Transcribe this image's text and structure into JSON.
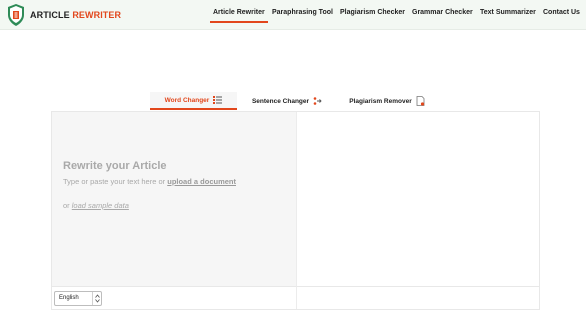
{
  "header": {
    "logo_text": "ARTICLE",
    "logo_accent": "REWRITER",
    "nav": [
      {
        "label": "Article Rewriter",
        "active": true
      },
      {
        "label": "Paraphrasing Tool",
        "active": false
      },
      {
        "label": "Plagiarism Checker",
        "active": false
      },
      {
        "label": "Grammar Checker",
        "active": false
      },
      {
        "label": "Text Summarizer",
        "active": false
      },
      {
        "label": "Contact Us",
        "active": false
      }
    ]
  },
  "mode_tabs": [
    {
      "label": "Word Changer",
      "active": true,
      "icon": "list-icon"
    },
    {
      "label": "Sentence Changer",
      "active": false,
      "icon": "swap-icon"
    },
    {
      "label": "Plagiarism Remover",
      "active": false,
      "icon": "document-icon"
    }
  ],
  "editor": {
    "title": "Rewrite your Article",
    "hint_prefix": "Type or paste your text here or",
    "upload_link": "upload a document",
    "sample_prefix": "or",
    "sample_link": "load sample data",
    "language": "English"
  },
  "colors": {
    "accent": "#e2471c",
    "brand_green": "#2e8b57",
    "header_bg": "#f3f8f3"
  }
}
